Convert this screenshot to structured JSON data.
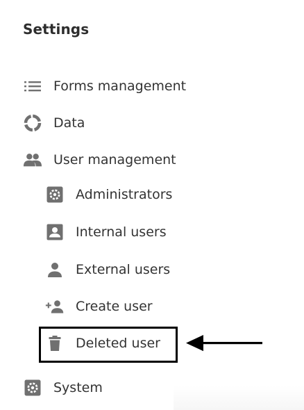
{
  "settings": {
    "title": "Settings"
  },
  "menu": {
    "forms_management": {
      "label": "Forms management",
      "icon": "list-icon"
    },
    "data": {
      "label": "Data",
      "icon": "donut-icon"
    },
    "user_management": {
      "label": "User management",
      "icon": "people-icon"
    },
    "administrators": {
      "label": "Administrators",
      "icon": "gear-box-icon"
    },
    "internal_users": {
      "label": "Internal users",
      "icon": "id-badge-icon"
    },
    "external_users": {
      "label": "External users",
      "icon": "person-icon"
    },
    "create_user": {
      "label": "Create user",
      "icon": "person-add-icon"
    },
    "deleted_user": {
      "label": "Deleted user",
      "icon": "trash-icon"
    },
    "system": {
      "label": "System",
      "icon": "gear-box-icon"
    }
  },
  "colors": {
    "icon": "#707070",
    "text": "#333333",
    "callout": "#000000"
  }
}
